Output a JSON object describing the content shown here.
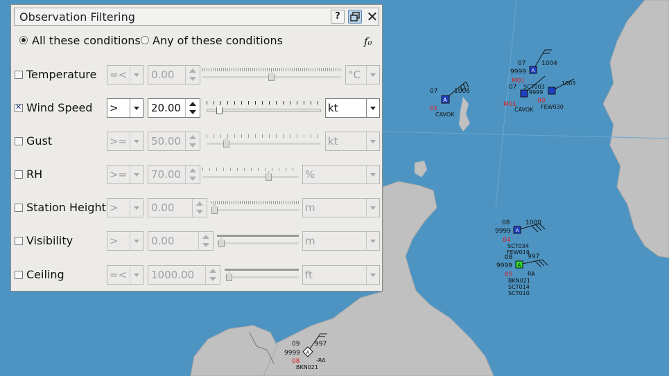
{
  "dialog": {
    "title": "Observation Filtering",
    "help_label": "?",
    "close_label": "✕",
    "formula_label": "f₀"
  },
  "mode": {
    "all_label": "All these conditions",
    "any_label": "Any of these conditions",
    "selected": "all"
  },
  "filters": [
    {
      "label": "Temperature",
      "enabled": false,
      "op": "=<",
      "value": "0.00",
      "unit": "°C",
      "slider_level": 0.5
    },
    {
      "label": "Wind Speed",
      "enabled": true,
      "op": ">",
      "value": "20.00",
      "unit": "kt",
      "slider_level": 0.1
    },
    {
      "label": "Gust",
      "enabled": false,
      "op": ">=",
      "value": "50.00",
      "unit": "kt",
      "slider_level": 0.15
    },
    {
      "label": "RH",
      "enabled": false,
      "op": ">=",
      "value": "70.00",
      "unit": "%",
      "slider_level": 0.7
    },
    {
      "label": "Station Height",
      "enabled": false,
      "op": ">",
      "value": "0.00",
      "unit": "m",
      "slider_level": 0.0
    },
    {
      "label": "Visibility",
      "enabled": false,
      "op": ">",
      "value": "0.00",
      "unit": "m",
      "slider_level": 0.0
    },
    {
      "label": "Ceiling",
      "enabled": false,
      "op": "=<",
      "value": "1000.00",
      "unit": "ft",
      "slider_level": 0.0
    }
  ],
  "stations": [
    {
      "texts": [
        "07",
        "1006",
        "01",
        "CAVOK"
      ],
      "type": "A",
      "fill": "#1f3fbf"
    },
    {
      "texts": [
        "07",
        "1004",
        "9999",
        "M01",
        "07",
        "SCT003",
        "9999",
        "M01",
        "CAVOK",
        "1003",
        "00",
        "FEW030"
      ],
      "type": "A",
      "fill": "#1f3fbf"
    },
    {
      "texts": [
        "08",
        "1000",
        "9999",
        "04",
        "SCT034",
        "FEW019"
      ],
      "type": "A",
      "fill": "#1f3fbf"
    },
    {
      "texts": [
        "08",
        "997",
        "9999",
        "05",
        "RA",
        "BKN021",
        "SCT014",
        "SCT010"
      ],
      "type": "A",
      "fill": "#2fdc2f"
    },
    {
      "texts": [
        "09",
        "997",
        "9999",
        "08",
        "-RA",
        "BKN021"
      ],
      "type": "A",
      "fill": "#ffffff"
    }
  ],
  "colors": {
    "sea": "#4d94c2",
    "land": "#c0c0c0",
    "alert_text": "#e01818"
  }
}
